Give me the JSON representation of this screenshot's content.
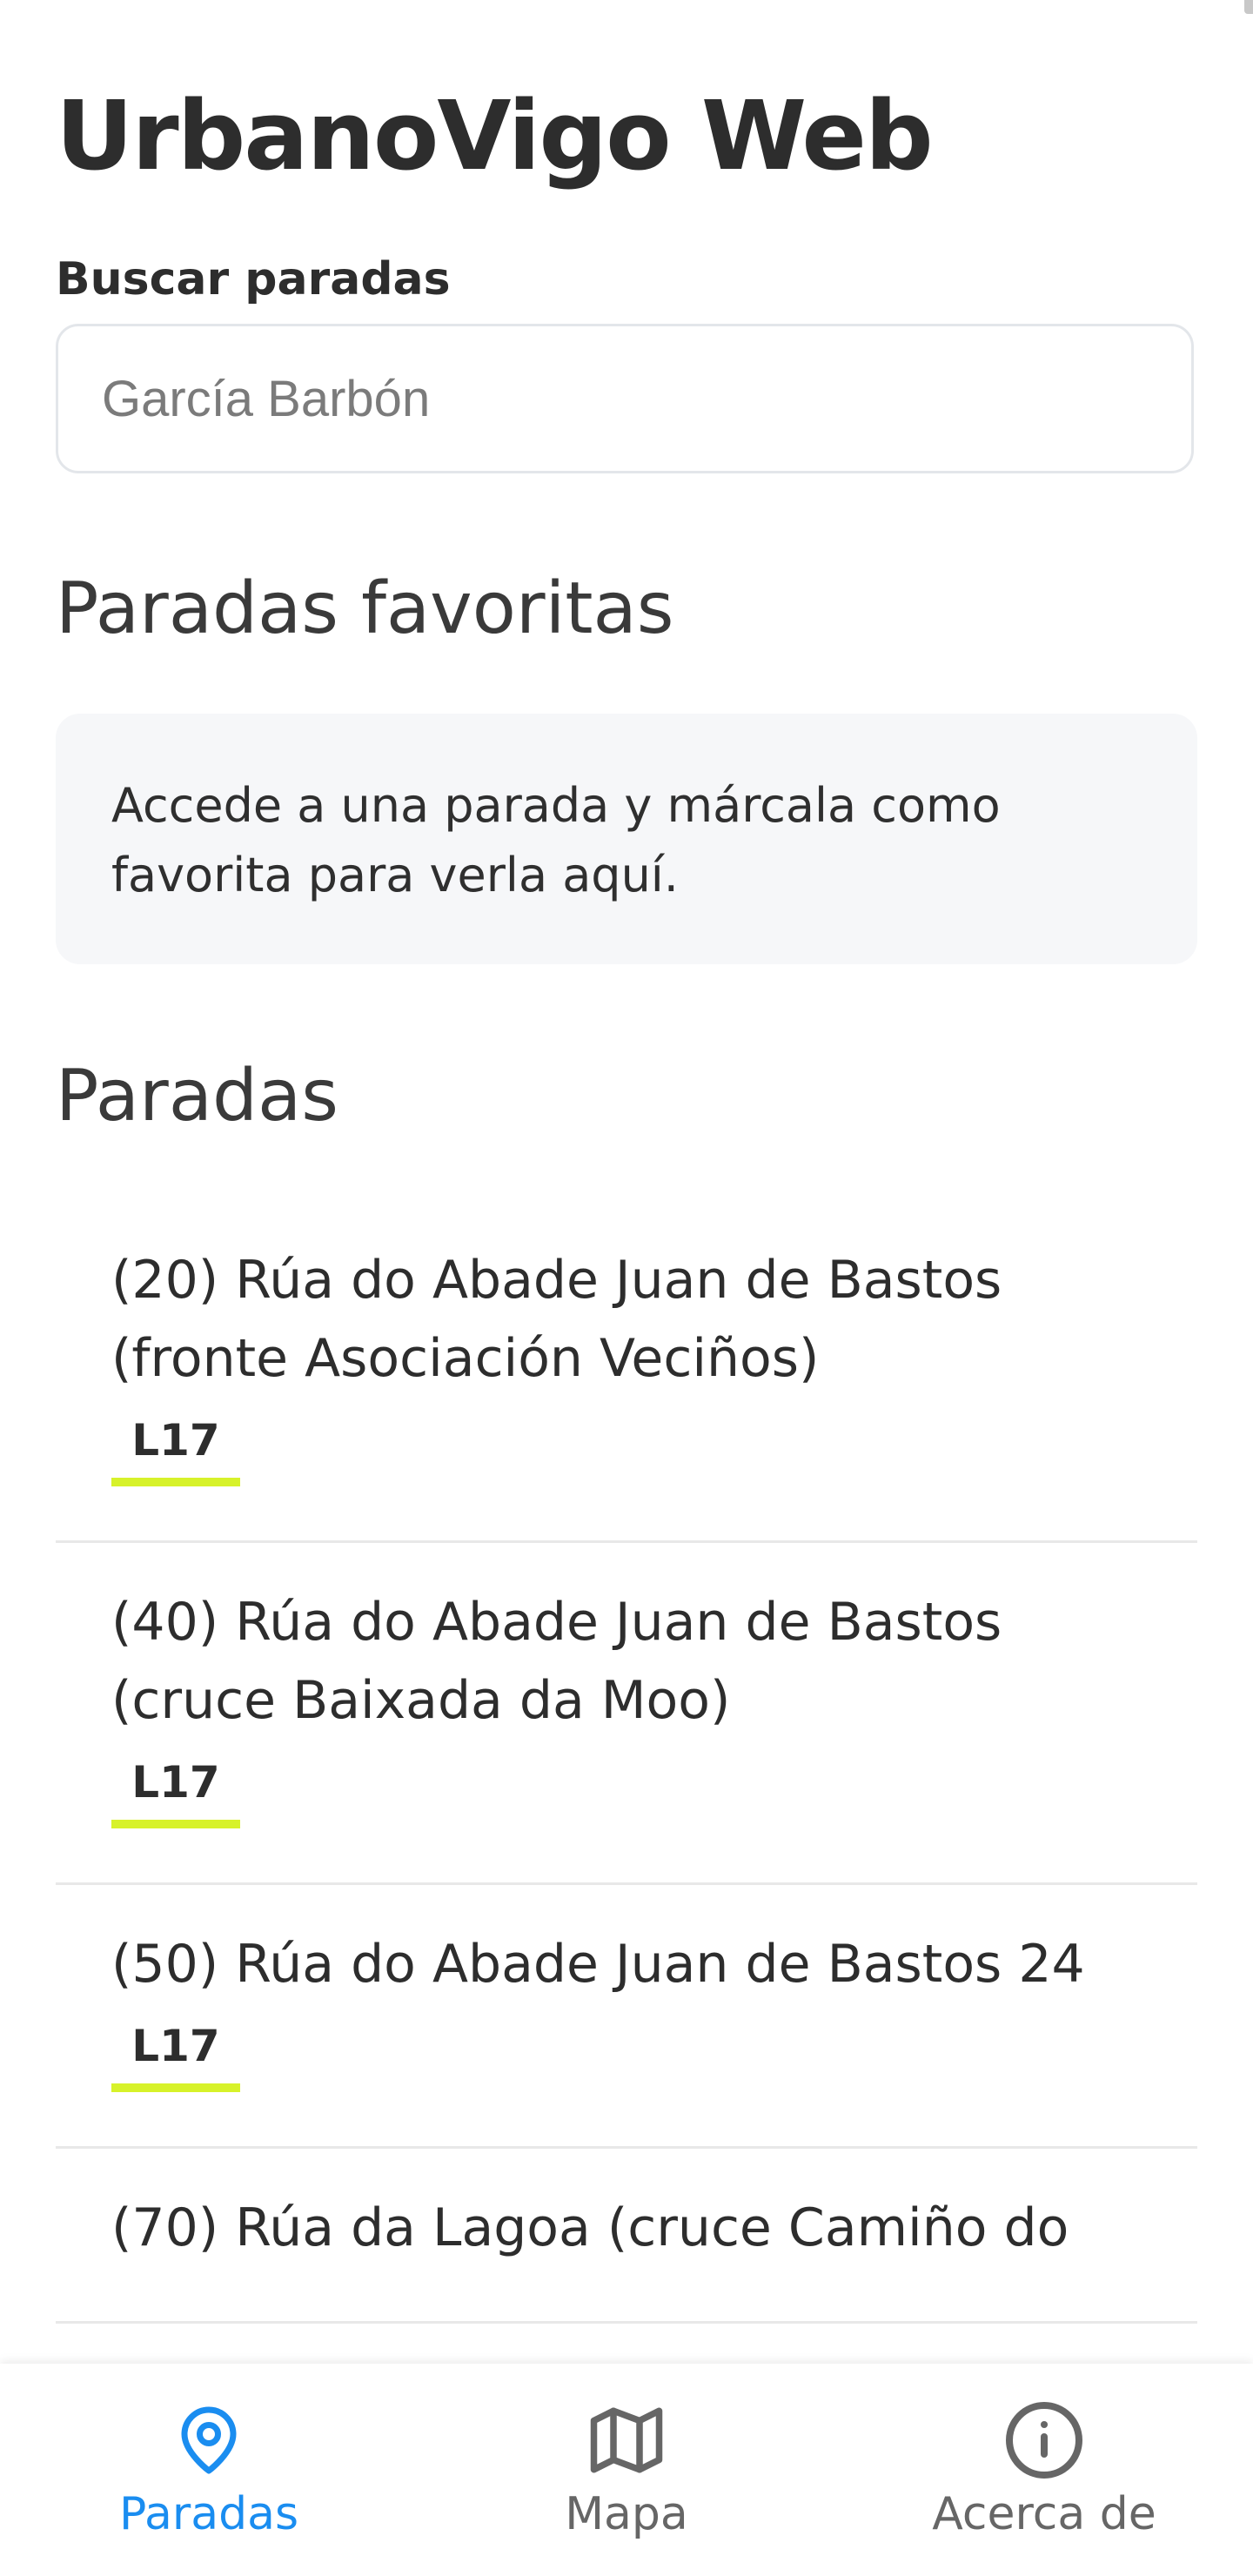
{
  "app": {
    "title": "UrbanoVigo Web"
  },
  "search": {
    "label": "Buscar paradas",
    "placeholder": "García Barbón",
    "value": ""
  },
  "favorites": {
    "title": "Paradas favoritas",
    "empty_message": "Accede a una parada y márcala como favorita para verla aquí."
  },
  "stops": {
    "title": "Paradas",
    "items": [
      {
        "name": "(20) Rúa do Abade Juan de Bastos (fronte Asociación Veciños)",
        "line": "L17"
      },
      {
        "name": "(40) Rúa do Abade Juan de Bastos (cruce Baixada da Moo)",
        "line": "L17"
      },
      {
        "name": "(50) Rúa do Abade Juan de Bastos 24",
        "line": "L17"
      },
      {
        "name": "(70) Rúa da Lagoa (cruce Camiño do",
        "line": ""
      }
    ]
  },
  "nav": {
    "items": [
      {
        "label": "Paradas",
        "icon": "map-pin-icon",
        "active": true
      },
      {
        "label": "Mapa",
        "icon": "map-icon",
        "active": false
      },
      {
        "label": "Acerca de",
        "icon": "info-icon",
        "active": false
      }
    ]
  },
  "colors": {
    "accent": "#1a8df0",
    "line_underline": "#d7f22a",
    "card_background": "#f6f7f9",
    "nav_inactive": "#666666"
  }
}
